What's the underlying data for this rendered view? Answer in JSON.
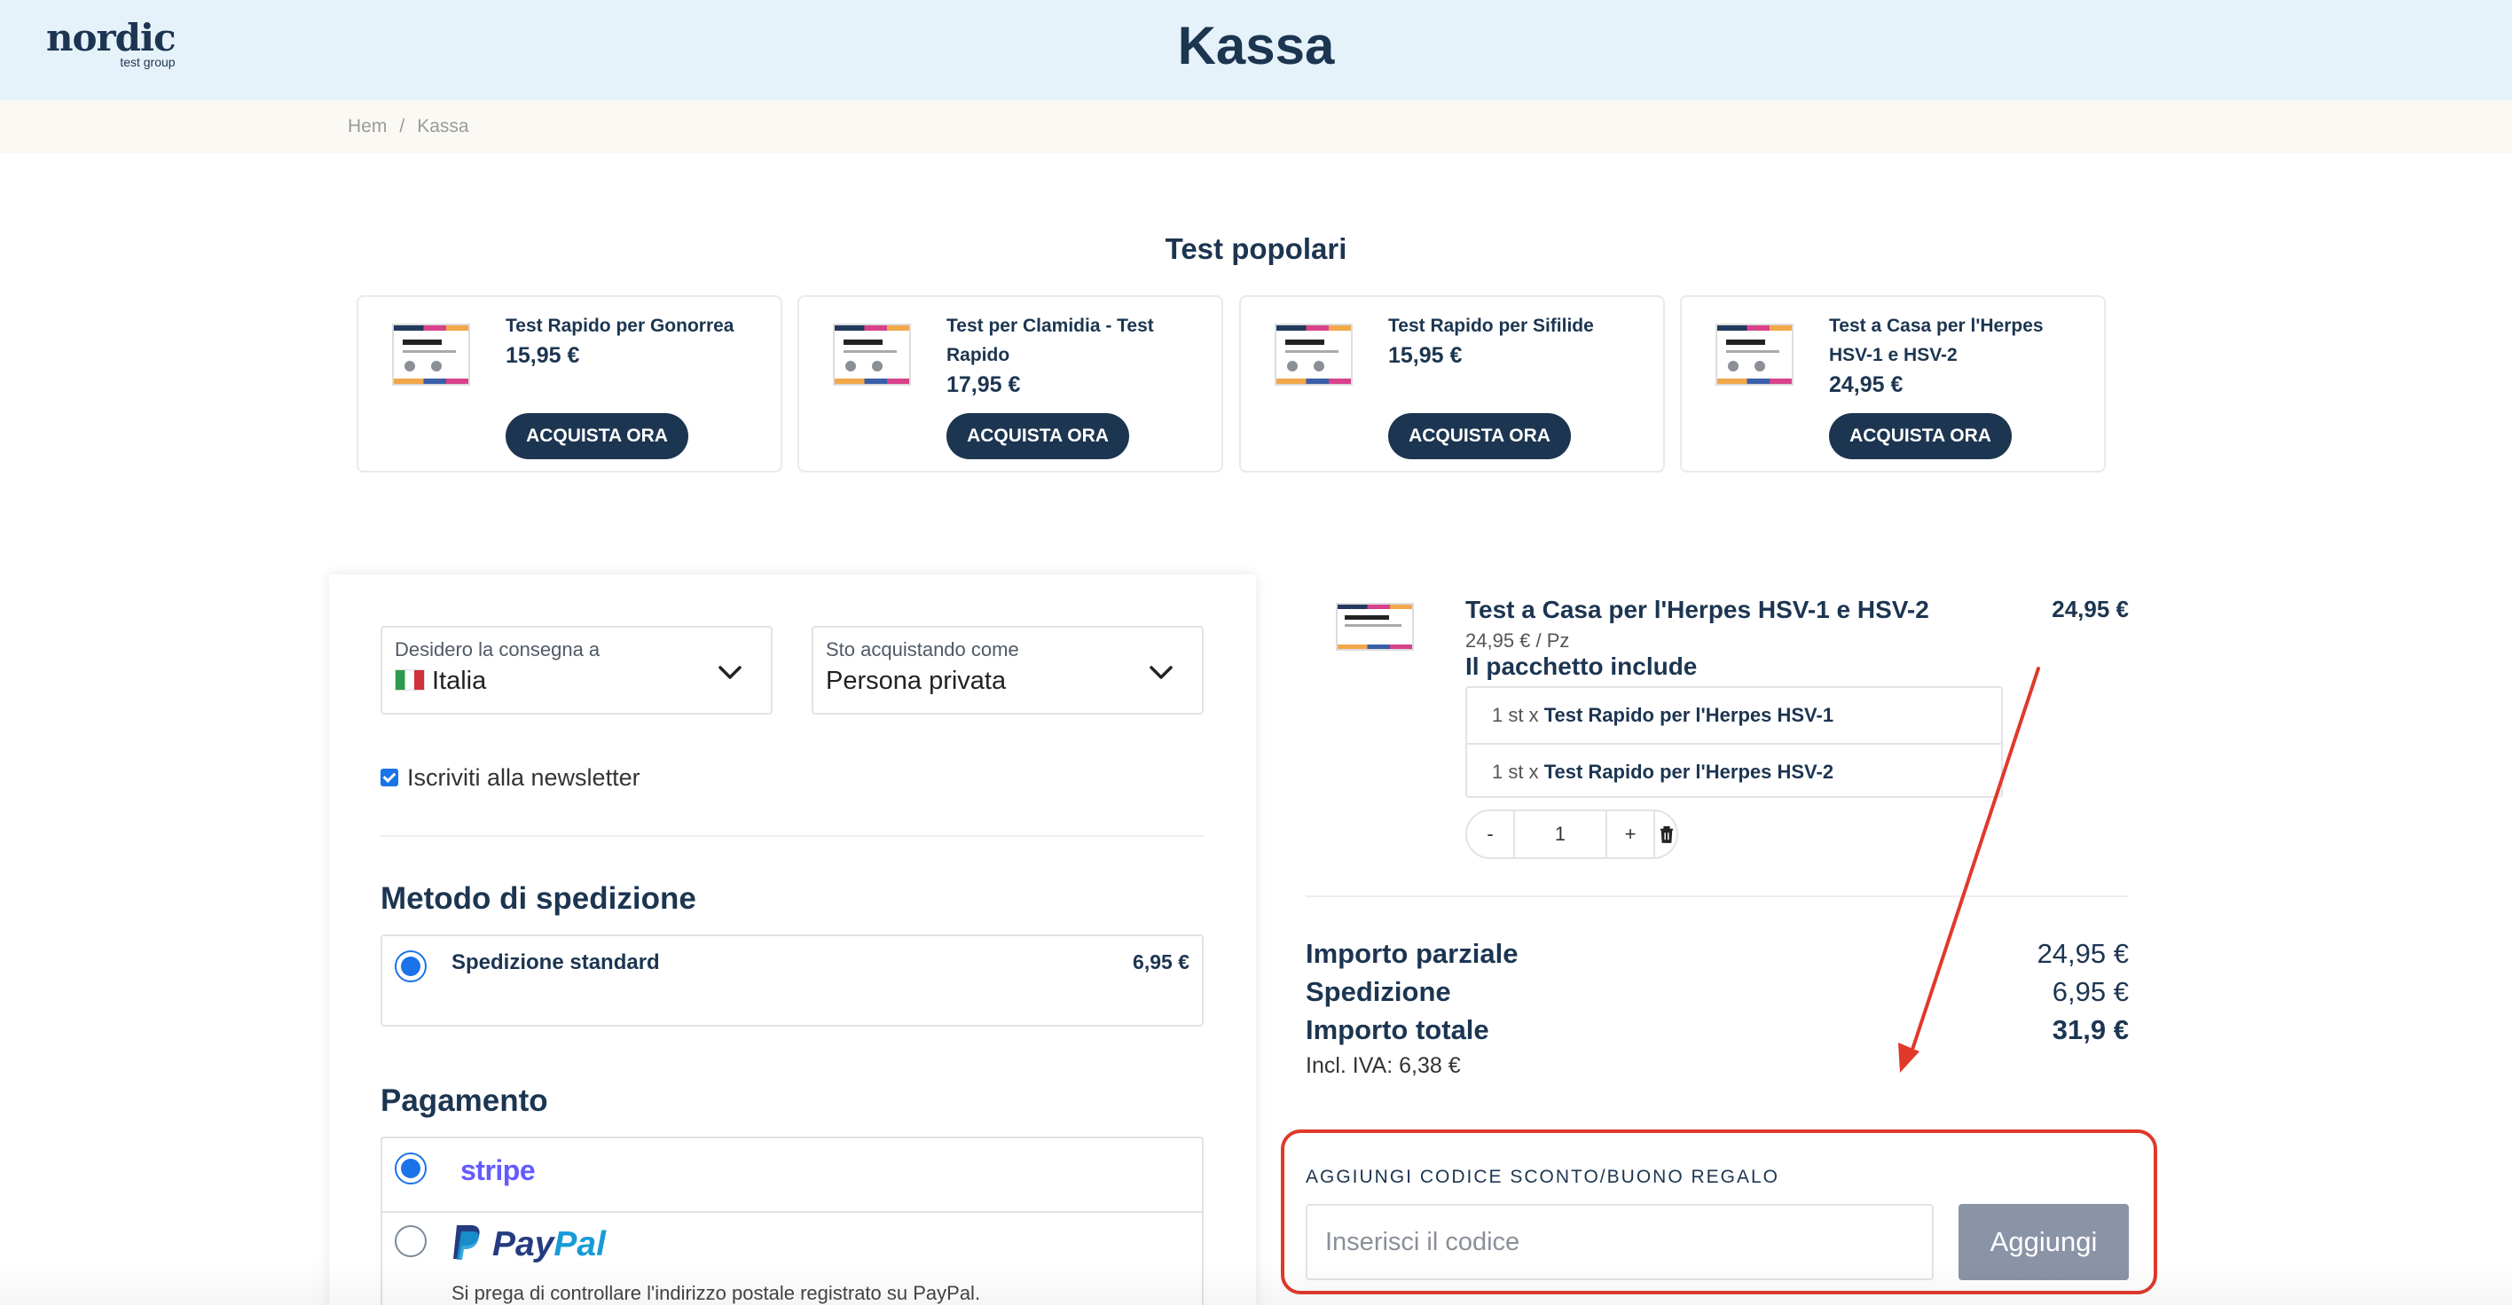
{
  "header": {
    "logo_main": "nordic",
    "logo_sub": "test group",
    "title": "Kassa"
  },
  "breadcrumb": {
    "home": "Hem",
    "separator": "/",
    "current": "Kassa"
  },
  "popular": {
    "title": "Test popolari",
    "cards": [
      {
        "name": "Test Rapido per Gonorrea",
        "price": "15,95 €",
        "button": "ACQUISTA ORA"
      },
      {
        "name": "Test per Clamidia - Test Rapido",
        "price": "17,95 €",
        "button": "ACQUISTA ORA"
      },
      {
        "name": "Test Rapido per Sifilide",
        "price": "15,95 €",
        "button": "ACQUISTA ORA"
      },
      {
        "name": "Test a Casa per l'Herpes HSV-1 e HSV-2",
        "price": "24,95 €",
        "button": "ACQUISTA ORA"
      }
    ]
  },
  "delivery": {
    "country_label": "Desidero la consegna a",
    "country_value": "Italia",
    "buyer_label": "Sto acquistando come",
    "buyer_value": "Persona privata",
    "newsletter_label": "Iscriviti alla newsletter",
    "newsletter_checked": true
  },
  "shipping": {
    "title": "Metodo di spedizione",
    "option_name": "Spedizione standard",
    "option_price": "6,95 €"
  },
  "payment": {
    "title": "Pagamento",
    "stripe_label": "stripe",
    "paypal_label_1": "Pay",
    "paypal_label_2": "Pal",
    "paypal_note": "Si prega di controllare l'indirizzo postale registrato su PayPal."
  },
  "cart": {
    "item_title": "Test a Casa per l'Herpes HSV-1 e HSV-2",
    "item_price": "24,95 €",
    "unit_price": "24,95 € / Pz",
    "includes_title": "Il pacchetto include",
    "includes": [
      {
        "qty": "1 st x",
        "name": "Test Rapido per l'Herpes HSV-1"
      },
      {
        "qty": "1 st x",
        "name": "Test Rapido per l'Herpes HSV-2"
      }
    ],
    "qty_minus": "-",
    "qty_value": "1",
    "qty_plus": "+"
  },
  "summary": {
    "subtotal_label": "Importo parziale",
    "subtotal_value": "24,95 €",
    "shipping_label": "Spedizione",
    "shipping_value": "6,95 €",
    "total_label": "Importo totale",
    "total_value": "31,9 €",
    "vat": "Incl. IVA: 6,38 €"
  },
  "discount": {
    "label": "AGGIUNGI CODICE SCONTO/BUONO REGALO",
    "placeholder": "Inserisci il codice",
    "button": "Aggiungi"
  },
  "colors": {
    "primary": "#1c3551",
    "accent_blue": "#1a73e8",
    "highlight_red": "#e0392b",
    "header_bg": "#e6f2f9"
  }
}
